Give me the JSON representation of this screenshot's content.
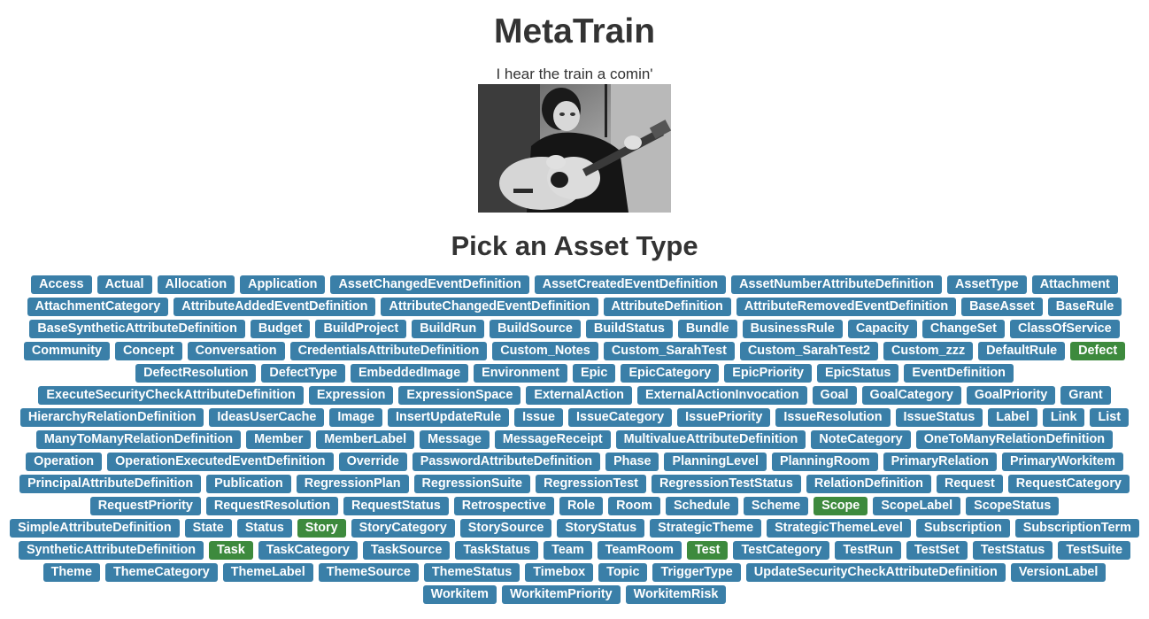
{
  "header": {
    "title": "MetaTrain",
    "tagline": "I hear the train a comin'"
  },
  "section": {
    "heading": "Pick an Asset Type"
  },
  "colors": {
    "tag_blue": "#3a7fa8",
    "tag_green": "#3d8a3d"
  },
  "asset_types": [
    {
      "label": "Access",
      "style": "blue"
    },
    {
      "label": "Actual",
      "style": "blue"
    },
    {
      "label": "Allocation",
      "style": "blue"
    },
    {
      "label": "Application",
      "style": "blue"
    },
    {
      "label": "AssetChangedEventDefinition",
      "style": "blue"
    },
    {
      "label": "AssetCreatedEventDefinition",
      "style": "blue"
    },
    {
      "label": "AssetNumberAttributeDefinition",
      "style": "blue"
    },
    {
      "label": "AssetType",
      "style": "blue"
    },
    {
      "label": "Attachment",
      "style": "blue"
    },
    {
      "label": "AttachmentCategory",
      "style": "blue"
    },
    {
      "label": "AttributeAddedEventDefinition",
      "style": "blue"
    },
    {
      "label": "AttributeChangedEventDefinition",
      "style": "blue"
    },
    {
      "label": "AttributeDefinition",
      "style": "blue"
    },
    {
      "label": "AttributeRemovedEventDefinition",
      "style": "blue"
    },
    {
      "label": "BaseAsset",
      "style": "blue"
    },
    {
      "label": "BaseRule",
      "style": "blue"
    },
    {
      "label": "BaseSyntheticAttributeDefinition",
      "style": "blue"
    },
    {
      "label": "Budget",
      "style": "blue"
    },
    {
      "label": "BuildProject",
      "style": "blue"
    },
    {
      "label": "BuildRun",
      "style": "blue"
    },
    {
      "label": "BuildSource",
      "style": "blue"
    },
    {
      "label": "BuildStatus",
      "style": "blue"
    },
    {
      "label": "Bundle",
      "style": "blue"
    },
    {
      "label": "BusinessRule",
      "style": "blue"
    },
    {
      "label": "Capacity",
      "style": "blue"
    },
    {
      "label": "ChangeSet",
      "style": "blue"
    },
    {
      "label": "ClassOfService",
      "style": "blue"
    },
    {
      "label": "Community",
      "style": "blue"
    },
    {
      "label": "Concept",
      "style": "blue"
    },
    {
      "label": "Conversation",
      "style": "blue"
    },
    {
      "label": "CredentialsAttributeDefinition",
      "style": "blue"
    },
    {
      "label": "Custom_Notes",
      "style": "blue"
    },
    {
      "label": "Custom_SarahTest",
      "style": "blue"
    },
    {
      "label": "Custom_SarahTest2",
      "style": "blue"
    },
    {
      "label": "Custom_zzz",
      "style": "blue"
    },
    {
      "label": "DefaultRule",
      "style": "blue"
    },
    {
      "label": "Defect",
      "style": "green"
    },
    {
      "label": "DefectResolution",
      "style": "blue"
    },
    {
      "label": "DefectType",
      "style": "blue"
    },
    {
      "label": "EmbeddedImage",
      "style": "blue"
    },
    {
      "label": "Environment",
      "style": "blue"
    },
    {
      "label": "Epic",
      "style": "blue"
    },
    {
      "label": "EpicCategory",
      "style": "blue"
    },
    {
      "label": "EpicPriority",
      "style": "blue"
    },
    {
      "label": "EpicStatus",
      "style": "blue"
    },
    {
      "label": "EventDefinition",
      "style": "blue"
    },
    {
      "label": "ExecuteSecurityCheckAttributeDefinition",
      "style": "blue"
    },
    {
      "label": "Expression",
      "style": "blue"
    },
    {
      "label": "ExpressionSpace",
      "style": "blue"
    },
    {
      "label": "ExternalAction",
      "style": "blue"
    },
    {
      "label": "ExternalActionInvocation",
      "style": "blue"
    },
    {
      "label": "Goal",
      "style": "blue"
    },
    {
      "label": "GoalCategory",
      "style": "blue"
    },
    {
      "label": "GoalPriority",
      "style": "blue"
    },
    {
      "label": "Grant",
      "style": "blue"
    },
    {
      "label": "HierarchyRelationDefinition",
      "style": "blue"
    },
    {
      "label": "IdeasUserCache",
      "style": "blue"
    },
    {
      "label": "Image",
      "style": "blue"
    },
    {
      "label": "InsertUpdateRule",
      "style": "blue"
    },
    {
      "label": "Issue",
      "style": "blue"
    },
    {
      "label": "IssueCategory",
      "style": "blue"
    },
    {
      "label": "IssuePriority",
      "style": "blue"
    },
    {
      "label": "IssueResolution",
      "style": "blue"
    },
    {
      "label": "IssueStatus",
      "style": "blue"
    },
    {
      "label": "Label",
      "style": "blue"
    },
    {
      "label": "Link",
      "style": "blue"
    },
    {
      "label": "List",
      "style": "blue"
    },
    {
      "label": "ManyToManyRelationDefinition",
      "style": "blue"
    },
    {
      "label": "Member",
      "style": "blue"
    },
    {
      "label": "MemberLabel",
      "style": "blue"
    },
    {
      "label": "Message",
      "style": "blue"
    },
    {
      "label": "MessageReceipt",
      "style": "blue"
    },
    {
      "label": "MultivalueAttributeDefinition",
      "style": "blue"
    },
    {
      "label": "NoteCategory",
      "style": "blue"
    },
    {
      "label": "OneToManyRelationDefinition",
      "style": "blue"
    },
    {
      "label": "Operation",
      "style": "blue"
    },
    {
      "label": "OperationExecutedEventDefinition",
      "style": "blue"
    },
    {
      "label": "Override",
      "style": "blue"
    },
    {
      "label": "PasswordAttributeDefinition",
      "style": "blue"
    },
    {
      "label": "Phase",
      "style": "blue"
    },
    {
      "label": "PlanningLevel",
      "style": "blue"
    },
    {
      "label": "PlanningRoom",
      "style": "blue"
    },
    {
      "label": "PrimaryRelation",
      "style": "blue"
    },
    {
      "label": "PrimaryWorkitem",
      "style": "blue"
    },
    {
      "label": "PrincipalAttributeDefinition",
      "style": "blue"
    },
    {
      "label": "Publication",
      "style": "blue"
    },
    {
      "label": "RegressionPlan",
      "style": "blue"
    },
    {
      "label": "RegressionSuite",
      "style": "blue"
    },
    {
      "label": "RegressionTest",
      "style": "blue"
    },
    {
      "label": "RegressionTestStatus",
      "style": "blue"
    },
    {
      "label": "RelationDefinition",
      "style": "blue"
    },
    {
      "label": "Request",
      "style": "blue"
    },
    {
      "label": "RequestCategory",
      "style": "blue"
    },
    {
      "label": "RequestPriority",
      "style": "blue"
    },
    {
      "label": "RequestResolution",
      "style": "blue"
    },
    {
      "label": "RequestStatus",
      "style": "blue"
    },
    {
      "label": "Retrospective",
      "style": "blue"
    },
    {
      "label": "Role",
      "style": "blue"
    },
    {
      "label": "Room",
      "style": "blue"
    },
    {
      "label": "Schedule",
      "style": "blue"
    },
    {
      "label": "Scheme",
      "style": "blue"
    },
    {
      "label": "Scope",
      "style": "green"
    },
    {
      "label": "ScopeLabel",
      "style": "blue"
    },
    {
      "label": "ScopeStatus",
      "style": "blue"
    },
    {
      "label": "SimpleAttributeDefinition",
      "style": "blue"
    },
    {
      "label": "State",
      "style": "blue"
    },
    {
      "label": "Status",
      "style": "blue"
    },
    {
      "label": "Story",
      "style": "green"
    },
    {
      "label": "StoryCategory",
      "style": "blue"
    },
    {
      "label": "StorySource",
      "style": "blue"
    },
    {
      "label": "StoryStatus",
      "style": "blue"
    },
    {
      "label": "StrategicTheme",
      "style": "blue"
    },
    {
      "label": "StrategicThemeLevel",
      "style": "blue"
    },
    {
      "label": "Subscription",
      "style": "blue"
    },
    {
      "label": "SubscriptionTerm",
      "style": "blue"
    },
    {
      "label": "SyntheticAttributeDefinition",
      "style": "blue"
    },
    {
      "label": "Task",
      "style": "green"
    },
    {
      "label": "TaskCategory",
      "style": "blue"
    },
    {
      "label": "TaskSource",
      "style": "blue"
    },
    {
      "label": "TaskStatus",
      "style": "blue"
    },
    {
      "label": "Team",
      "style": "blue"
    },
    {
      "label": "TeamRoom",
      "style": "blue"
    },
    {
      "label": "Test",
      "style": "green"
    },
    {
      "label": "TestCategory",
      "style": "blue"
    },
    {
      "label": "TestRun",
      "style": "blue"
    },
    {
      "label": "TestSet",
      "style": "blue"
    },
    {
      "label": "TestStatus",
      "style": "blue"
    },
    {
      "label": "TestSuite",
      "style": "blue"
    },
    {
      "label": "Theme",
      "style": "blue"
    },
    {
      "label": "ThemeCategory",
      "style": "blue"
    },
    {
      "label": "ThemeLabel",
      "style": "blue"
    },
    {
      "label": "ThemeSource",
      "style": "blue"
    },
    {
      "label": "ThemeStatus",
      "style": "blue"
    },
    {
      "label": "Timebox",
      "style": "blue"
    },
    {
      "label": "Topic",
      "style": "blue"
    },
    {
      "label": "TriggerType",
      "style": "blue"
    },
    {
      "label": "UpdateSecurityCheckAttributeDefinition",
      "style": "blue"
    },
    {
      "label": "VersionLabel",
      "style": "blue"
    },
    {
      "label": "Workitem",
      "style": "blue"
    },
    {
      "label": "WorkitemPriority",
      "style": "blue"
    },
    {
      "label": "WorkitemRisk",
      "style": "blue"
    }
  ]
}
